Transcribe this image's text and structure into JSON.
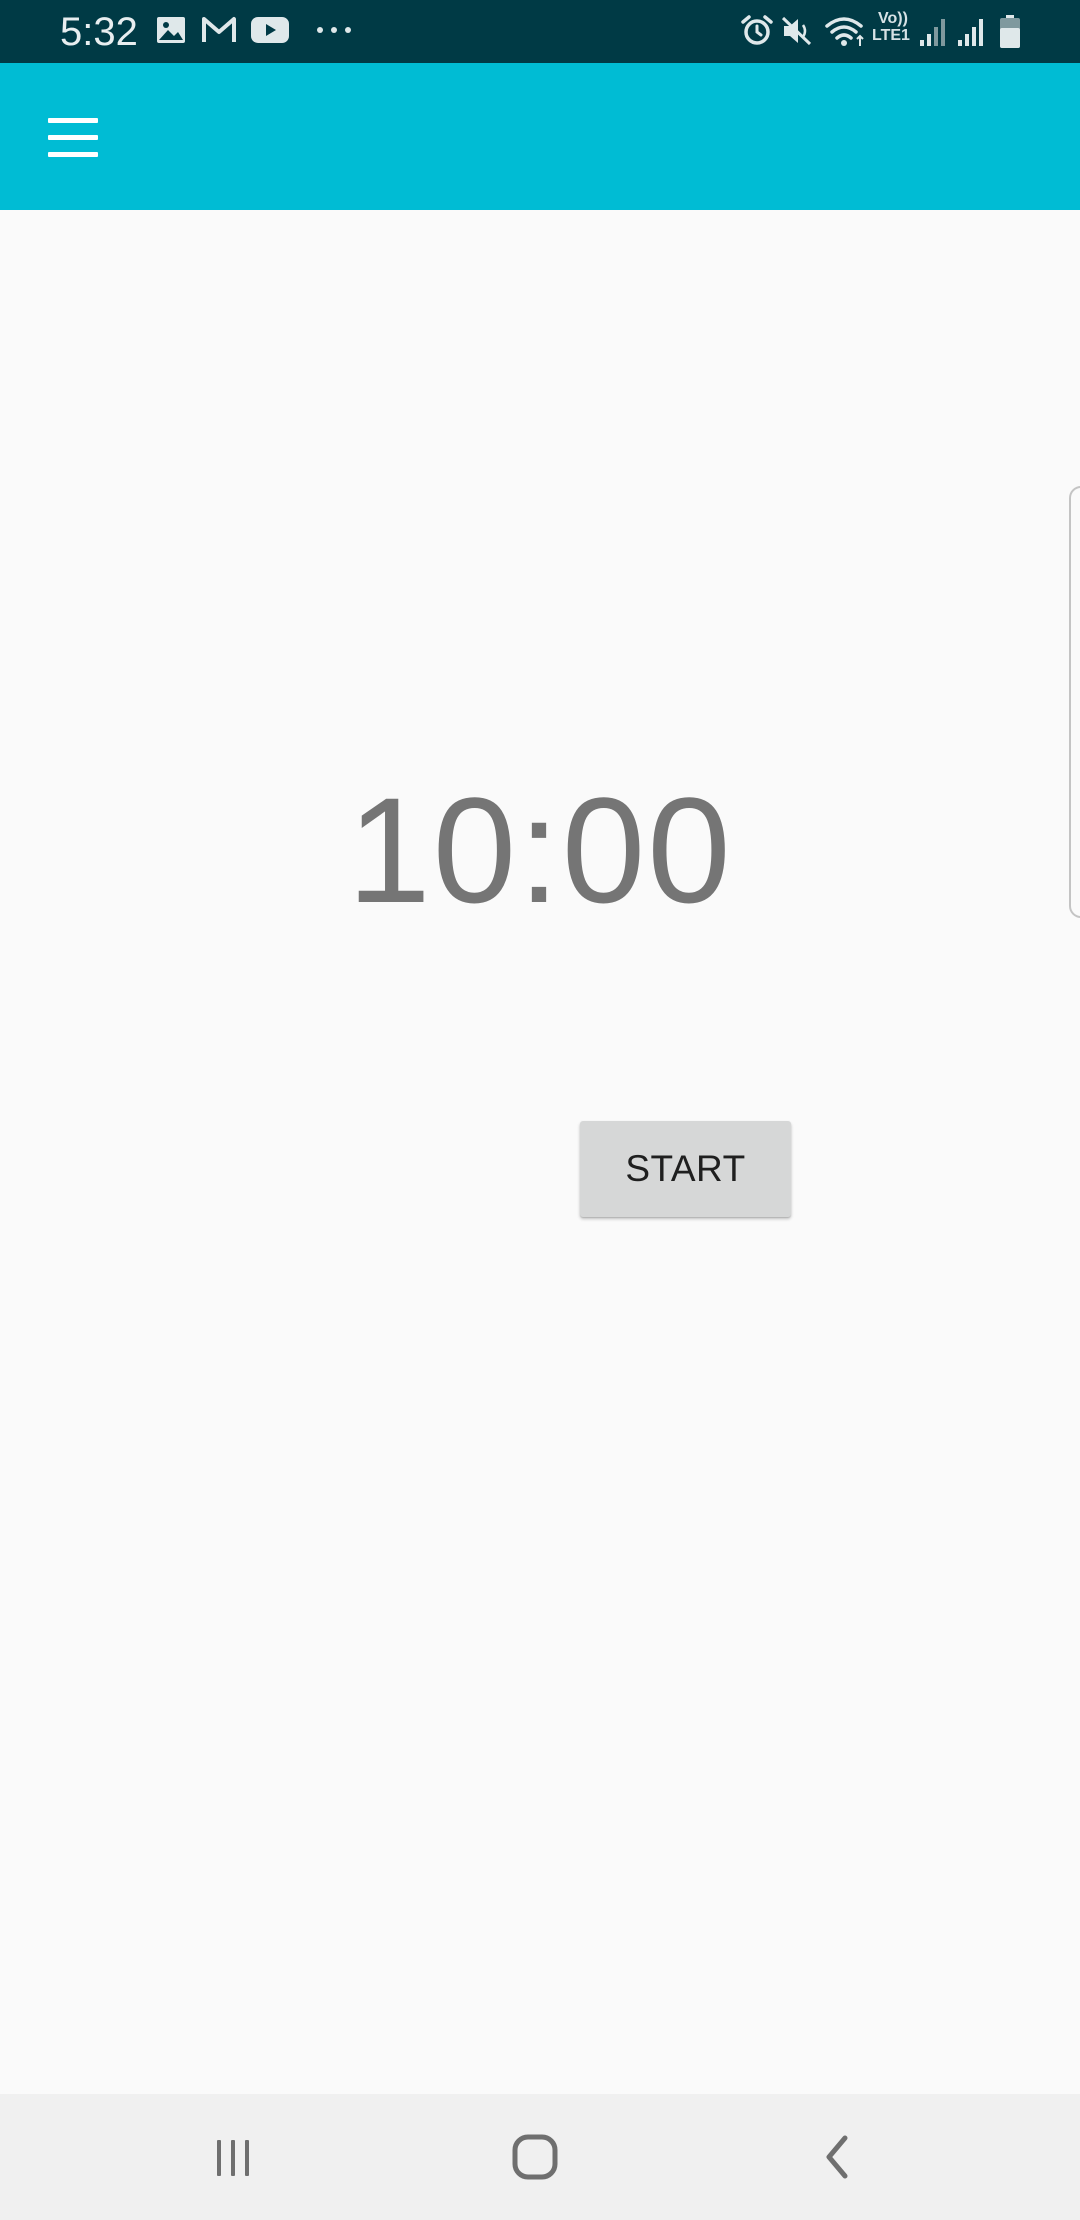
{
  "status_bar": {
    "time": "5:32",
    "network_label_top": "Vo))",
    "network_label_bottom": "LTE1",
    "icons": [
      "gallery-icon",
      "gmail-icon",
      "youtube-icon",
      "more-dots-icon",
      "alarm-icon",
      "mute-icon",
      "wifi-icon",
      "signal-icon",
      "signal-icon-2",
      "battery-icon"
    ],
    "background_color": "#003a45"
  },
  "app_bar": {
    "background_color": "#00bcd4",
    "menu_icon": "hamburger-menu-icon"
  },
  "main": {
    "timer": "10:00",
    "start_label": "START"
  },
  "nav_bar": {
    "icons": [
      "recent-apps-icon",
      "home-icon",
      "back-icon"
    ]
  }
}
